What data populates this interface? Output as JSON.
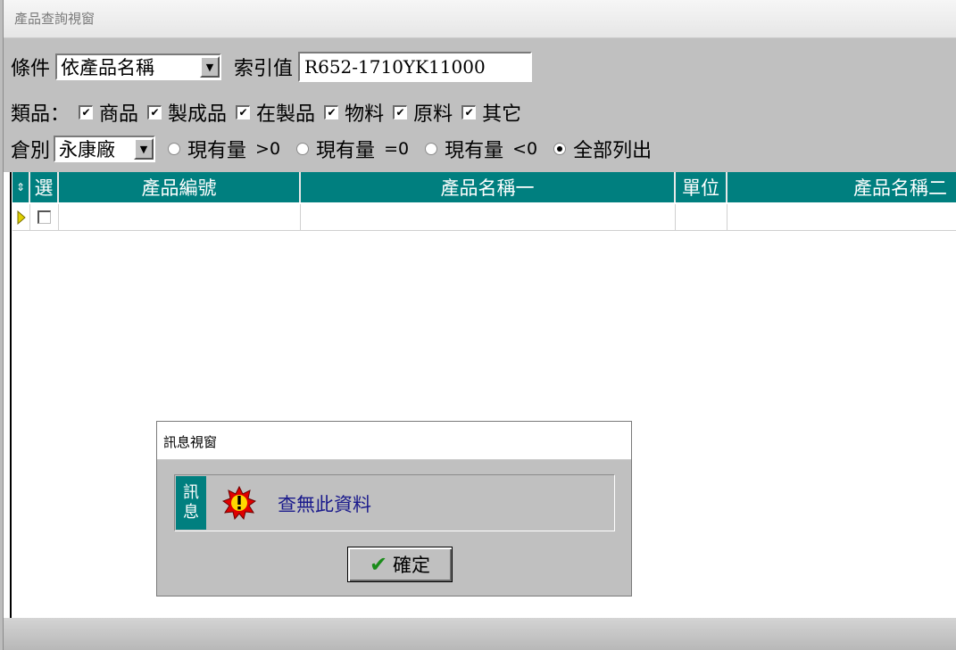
{
  "window": {
    "title": "產品查詢視窗"
  },
  "criteria": {
    "condition_label": "條件",
    "condition_value": "依產品名稱",
    "index_label": "索引值",
    "index_value": "R652-1710YK11000"
  },
  "categories": {
    "label": "類品：",
    "items": [
      {
        "label": "商品",
        "checked": true
      },
      {
        "label": "製成品",
        "checked": true
      },
      {
        "label": "在製品",
        "checked": true
      },
      {
        "label": "物料",
        "checked": true
      },
      {
        "label": "原料",
        "checked": true
      },
      {
        "label": "其它",
        "checked": true
      }
    ]
  },
  "warehouse": {
    "label": "倉別",
    "value": "永康廠",
    "options": [
      {
        "label": "現有量",
        "cond": ">0",
        "selected": false
      },
      {
        "label": "現有量",
        "cond": "=0",
        "selected": false
      },
      {
        "label": "現有量",
        "cond": "<0",
        "selected": false
      },
      {
        "label": "全部列出",
        "cond": "",
        "selected": true
      }
    ]
  },
  "grid": {
    "headers": {
      "select": "選",
      "code": "產品編號",
      "name1": "產品名稱一",
      "unit": "單位",
      "name2": "產品名稱二"
    },
    "header_color": "#007f7f"
  },
  "dialog": {
    "title": "訊息視窗",
    "tag_line1": "訊",
    "tag_line2": "息",
    "message": "查無此資料",
    "ok_label": "確定"
  }
}
